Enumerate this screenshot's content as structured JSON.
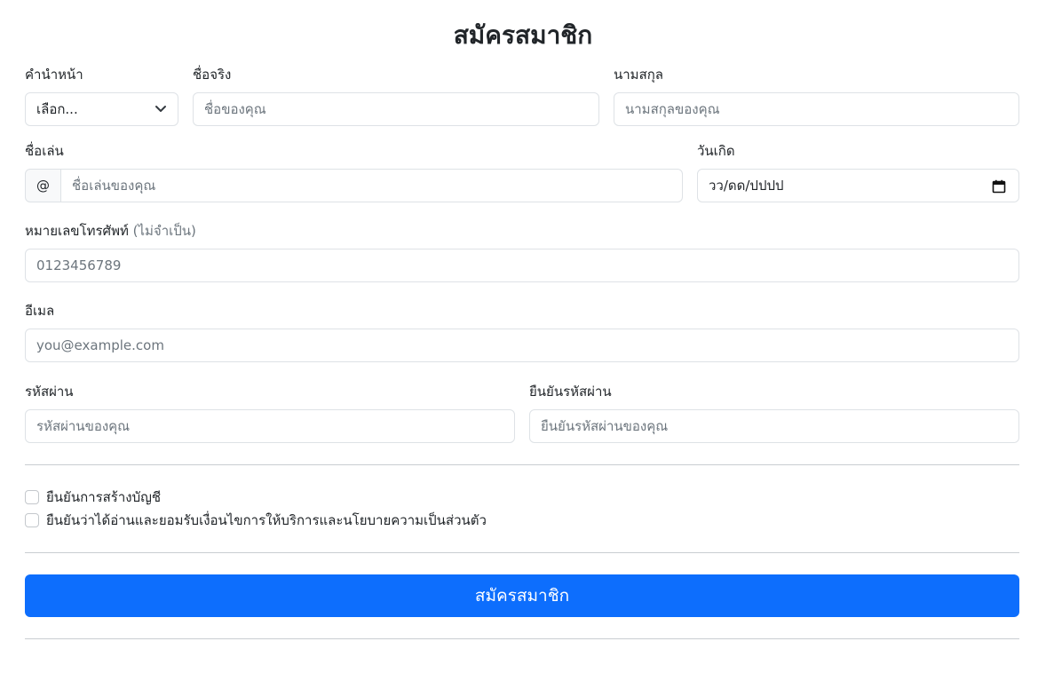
{
  "form": {
    "title": "สมัครสมาชิก",
    "prefix": {
      "label": "คำนำหน้า",
      "selected": "เลือก..."
    },
    "first_name": {
      "label": "ชื่อจริง",
      "placeholder": "ชื่อของคุณ"
    },
    "last_name": {
      "label": "นามสกุล",
      "placeholder": "นามสกุลของคุณ"
    },
    "nickname": {
      "label": "ชื่อเล่น",
      "addon": "@",
      "placeholder": "ชื่อเล่นของคุณ"
    },
    "birthdate": {
      "label": "วันเกิด",
      "value": "วว/ดด/ปปปป"
    },
    "phone": {
      "label": "หมายเลขโทรศัพท์",
      "optional": "(ไม่จำเป็น)",
      "placeholder": "0123456789"
    },
    "email": {
      "label": "อีเมล",
      "placeholder": "you@example.com"
    },
    "password": {
      "label": "รหัสผ่าน",
      "placeholder": "รหัสผ่านของคุณ"
    },
    "confirm_password": {
      "label": "ยืนยันรหัสผ่าน",
      "placeholder": "ยืนยันรหัสผ่านของคุณ"
    },
    "checks": [
      {
        "label": "ยืนยันการสร้างบัญชี",
        "checked": false
      },
      {
        "label": "ยืนยันว่าได้อ่านและยอมรับเงื่อนไขการให้บริการและนโยบายความเป็นส่วนตัว",
        "checked": false
      }
    ],
    "submit_label": "สมัครสมาชิก"
  },
  "colors": {
    "primary": "#0d6efd",
    "border": "#dee2e6",
    "placeholder": "#6c757d",
    "text": "#212529"
  },
  "icons": {
    "select": "chevron-down-icon",
    "date": "calendar-icon"
  }
}
